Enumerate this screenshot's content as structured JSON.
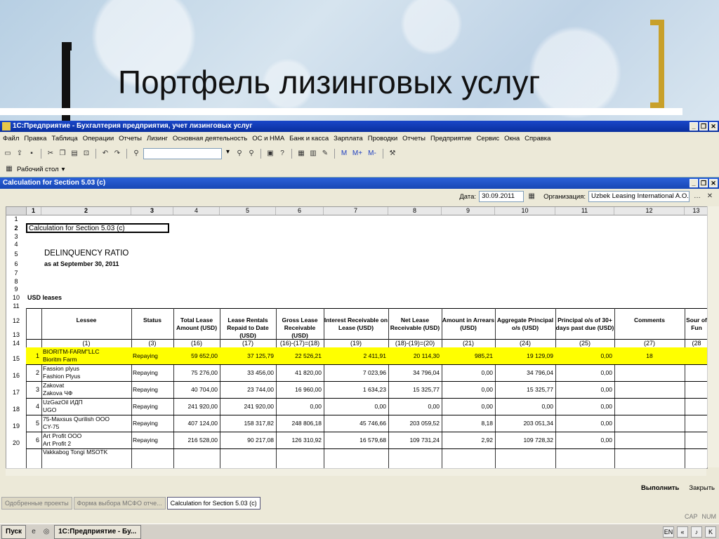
{
  "slide": {
    "title": "Портфель лизинговых услуг"
  },
  "app": {
    "title": "1С:Предприятие - Бухгалтерия предприятия, учет лизинговых услуг",
    "menu": [
      "Файл",
      "Правка",
      "Таблица",
      "Операции",
      "Отчеты",
      "Лизинг",
      "Основная деятельность",
      "ОС и НМА",
      "Банк и касса",
      "Зарплата",
      "Проводки",
      "Отчеты",
      "Предприятие",
      "Сервис",
      "Окна",
      "Справка"
    ],
    "desktop_label": "Рабочий стол"
  },
  "report_window": {
    "title": "Calculation for Section 5.03 (c)",
    "date_label": "Дата:",
    "date_value": "30.09.2011",
    "org_label": "Организация:",
    "org_value": "Uzbek Leasing International A.O.",
    "col_numbers": [
      "1",
      "2",
      "3",
      "4",
      "5",
      "6",
      "7",
      "8",
      "9",
      "10",
      "11",
      "12",
      "13"
    ],
    "row_numbers": [
      "1",
      "2",
      "3",
      "4",
      "5",
      "6",
      "7",
      "8",
      "9",
      "10",
      "11",
      "12",
      "13",
      "14",
      "15",
      "16",
      "17",
      "18",
      "19",
      "20"
    ],
    "box_title": "Calculation for Section 5.03 (c)",
    "heading": "DELINQUENCY RATIO",
    "subheading": "as at September 30, 2011",
    "section": "USD leases",
    "headers": [
      "Lessee",
      "Status",
      "Total Lease Amount (USD)",
      "Lease Rentals Repaid to Date (USD)",
      "Gross Lease Receivable (USD)",
      "Interest Receivable on Lease (USD)",
      "Net Lease Receivable (USD)",
      "Amount in Arrears (USD)",
      "Aggregate Principal o/s (USD)",
      "Principal o/s of 30+ days past due (USD)",
      "Comments",
      "Sour of Fun"
    ],
    "codes": [
      "(1)",
      "(3)",
      "(16)",
      "(17)",
      "(16)-(17)=(18)",
      "(19)",
      "(18)-(19)=(20)",
      "(21)",
      "(24)",
      "(25)",
      "(27)",
      "(28"
    ],
    "rows": [
      {
        "n": "1",
        "l1": "BIORITM-FARM\"LLC",
        "l2": "Bioritm Farm",
        "status": "Repaying",
        "v": [
          "59 652,00",
          "37 125,79",
          "22 526,21",
          "2 411,91",
          "20 114,30",
          "985,21",
          "19 129,09",
          "0,00"
        ],
        "comment": "18"
      },
      {
        "n": "2",
        "l1": "Fassion plyus",
        "l2": "Fashion Plyus",
        "status": "Repaying",
        "v": [
          "75 276,00",
          "33 456,00",
          "41 820,00",
          "7 023,96",
          "34 796,04",
          "0,00",
          "34 796,04",
          "0,00"
        ],
        "comment": ""
      },
      {
        "n": "3",
        "l1": "Zakovat",
        "l2": "Zakova ЧФ",
        "status": "Repaying",
        "v": [
          "40 704,00",
          "23 744,00",
          "16 960,00",
          "1 634,23",
          "15 325,77",
          "0,00",
          "15 325,77",
          "0,00"
        ],
        "comment": ""
      },
      {
        "n": "4",
        "l1": "UzGazOil ИДП",
        "l2": "UGO",
        "status": "Repaying",
        "v": [
          "241 920,00",
          "241 920,00",
          "0,00",
          "0,00",
          "0,00",
          "0,00",
          "0,00",
          "0,00"
        ],
        "comment": ""
      },
      {
        "n": "5",
        "l1": "75-Maxsus Qurilish OOO",
        "l2": "CY-75",
        "status": "Repaying",
        "v": [
          "407 124,00",
          "158 317,82",
          "248 806,18",
          "45 746,66",
          "203 059,52",
          "8,18",
          "203 051,34",
          "0,00"
        ],
        "comment": ""
      },
      {
        "n": "6",
        "l1": "Art Profit OOO",
        "l2": "Art Profit 2",
        "status": "Repaying",
        "v": [
          "216 528,00",
          "90 217,08",
          "126 310,92",
          "16 579,68",
          "109 731,24",
          "2,92",
          "109 728,32",
          "0,00"
        ],
        "comment": ""
      }
    ],
    "cut_row": "Vakkabog Tongi MSOTK",
    "btn_execute": "Выполнить",
    "btn_close": "Закрыть"
  },
  "window_tabs": [
    "Одобренные проекты",
    "Форма выбора МСФО отче...",
    "Calculation for Section 5.03 (c)"
  ],
  "status": {
    "cap": "CAP",
    "num": "NUM"
  },
  "taskbar": {
    "start": "Пуск",
    "item": "1С:Предприятие - Бу...",
    "lang": "EN"
  }
}
